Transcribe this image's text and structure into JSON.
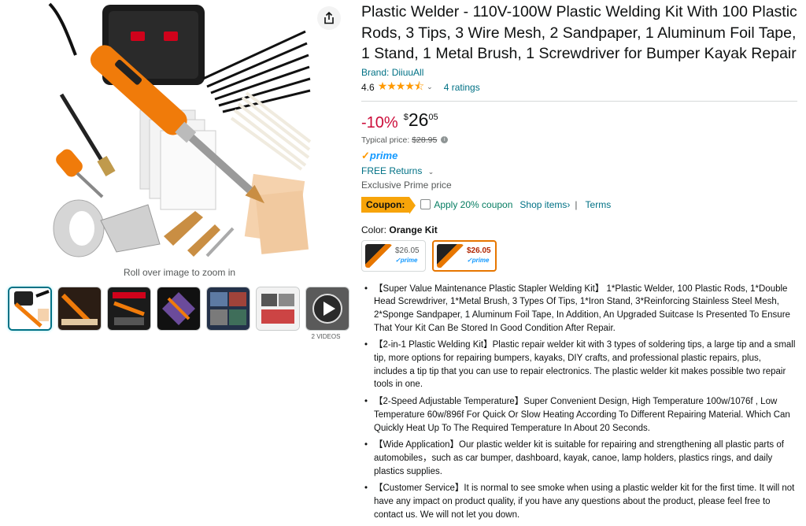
{
  "gallery": {
    "zoom_hint": "Roll over image to zoom in",
    "videos_label": "2 VIDEOS",
    "thumbnails": [
      {
        "kind": "image",
        "selected": true
      },
      {
        "kind": "image",
        "selected": false
      },
      {
        "kind": "image",
        "selected": false
      },
      {
        "kind": "image",
        "selected": false
      },
      {
        "kind": "image",
        "selected": false
      },
      {
        "kind": "image",
        "selected": false
      },
      {
        "kind": "video",
        "selected": false
      }
    ]
  },
  "product": {
    "title": "Plastic Welder - 110V-100W Plastic Welding Kit With 100 Plastic Rods, 3 Tips, 3 Wire Mesh, 2 Sandpaper, 1 Aluminum Foil Tape, 1 Stand, 1 Metal Brush, 1 Screwdriver for Bumper Kayak Repair",
    "brand": "Brand: DiiuuAll",
    "rating_value": "4.6",
    "stars_text": "★★★★⯪",
    "ratings_count": "4 ratings"
  },
  "price": {
    "discount": "-10%",
    "currency": "$",
    "whole": "26",
    "fraction": "05",
    "typical_label": "Typical price:",
    "typical_value": "$28.95",
    "prime_label": "prime",
    "free_returns": "FREE Returns",
    "exclusive": "Exclusive Prime price"
  },
  "coupon": {
    "badge": "Coupon:",
    "apply_text": "Apply 20% coupon",
    "shop_items": "Shop items›",
    "separator": "|",
    "terms": "Terms"
  },
  "color": {
    "label": "Color:",
    "selected_name": "Orange Kit",
    "options": [
      {
        "price": "$26.05",
        "prime": "✓prime",
        "selected": false
      },
      {
        "price": "$26.05",
        "prime": "✓prime",
        "selected": true
      }
    ]
  },
  "bullets": [
    "【Super Value Maintenance Plastic Stapler Welding Kit】 1*Plastic Welder, 100 Plastic Rods, 1*Double Head Screwdriver, 1*Metal Brush, 3 Types Of Tips, 1*Iron Stand, 3*Reinforcing Stainless Steel Mesh, 2*Sponge Sandpaper, 1 Aluminum Foil Tape, In Addition, An Upgraded Suitcase Is Presented To Ensure That Your Kit Can Be Stored In Good Condition After Repair.",
    "【2-in-1 Plastic Welding Kit】Plastic repair welder kit with 3 types of soldering tips, a large tip and a small tip, more options for repairing bumpers, kayaks, DIY crafts, and professional plastic repairs, plus, includes a tip tip that you can use to repair electronics. The plastic welder kit makes possible two repair tools in one.",
    "【2-Speed Adjustable Temperature】Super Convenient Design, High Temperature 100w/1076f , Low Temperature 60w/896f For Quick Or Slow Heating According To Different Repairing Material. Which Can Quickly Heat Up To The Required Temperature In About 20 Seconds.",
    "【Wide Application】Our plastic welder kit is suitable for repairing and strengthening all plastic parts of automobiles，such as car bumper, dashboard, kayak, canoe, lamp holders, plastics rings, and daily plastics supplies.",
    "【Customer Service】It is normal to see smoke when using a plastic welder kit for the first time. It will not have any impact on product quality, if you have any questions about the product, please feel free to contact us. We will not let you down."
  ],
  "colors": {
    "link": "#007185",
    "price_red": "#cc0c39",
    "prime_blue": "#1399ff",
    "coupon_orange": "#f7a40a",
    "selected_border": "#e77600"
  }
}
